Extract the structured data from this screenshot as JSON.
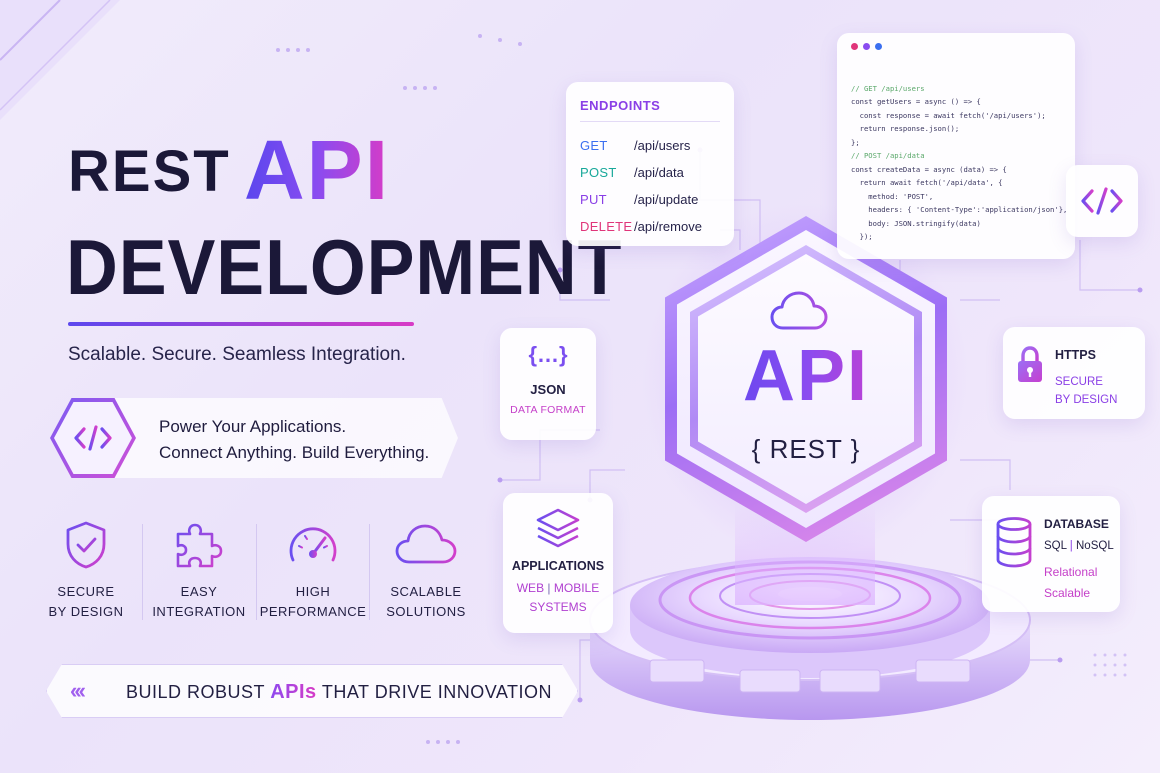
{
  "colors": {
    "accent_blue": "#5a46ee",
    "accent_purple": "#8a4cf0",
    "accent_pink": "#d83bc6",
    "dark_text": "#1b1838",
    "background": "#efe8fb"
  },
  "hero": {
    "rest": "REST",
    "api": "API",
    "development": "DEVELOPMENT",
    "tagline": "Scalable. Secure. Seamless Integration."
  },
  "power": {
    "icon": "code-icon",
    "line1": "Power Your Applications.",
    "line2": "Connect Anything. Build Everything."
  },
  "features": [
    {
      "icon": "shield-check-icon",
      "line1": "SECURE",
      "line2": "BY DESIGN"
    },
    {
      "icon": "puzzle-icon",
      "line1": "EASY",
      "line2": "INTEGRATION"
    },
    {
      "icon": "speedometer-icon",
      "line1": "HIGH",
      "line2": "PERFORMANCE"
    },
    {
      "icon": "cloud-icon",
      "line1": "SCALABLE",
      "line2": "SOLUTIONS"
    }
  ],
  "banner": {
    "chevrons": "‹‹‹",
    "pre": "BUILD ROBUST",
    "highlight": "APIs",
    "post": "THAT DRIVE INNOVATION"
  },
  "endpoints": {
    "title": "ENDPOINTS",
    "rows": [
      {
        "method": "GET",
        "path": "/api/users",
        "color": "#3b6ff0"
      },
      {
        "method": "POST",
        "path": "/api/data",
        "color": "#18a89a"
      },
      {
        "method": "PUT",
        "path": "/api/update",
        "color": "#8a3fe6"
      },
      {
        "method": "DELETE",
        "path": "/api/remove",
        "color": "#e0357a"
      }
    ]
  },
  "code": {
    "lines": [
      "// GET /api/users",
      "const getUsers = async () => {",
      "  const response = await fetch('/api/users');",
      "  return response.json();",
      "};",
      "",
      "// POST /api/data",
      "const createData = async (data) => {",
      "  return await fetch('/api/data', {",
      "    method: 'POST',",
      "    headers: { 'Content-Type':'application/json'},",
      "    body: JSON.stringify(data)",
      "  });"
    ]
  },
  "tag_icon": "code-icon",
  "json_card": {
    "icon": "{…}",
    "title": "JSON",
    "subtitle": "DATA FORMAT"
  },
  "https_card": {
    "icon": "lock-icon",
    "title": "HTTPS",
    "line1": "SECURE",
    "line2": "BY DESIGN"
  },
  "apps_card": {
    "icon": "layers-icon",
    "title": "APPLICATIONS",
    "web": "WEB",
    "mobile": "MOBILE",
    "systems": "SYSTEMS",
    "sep": "|"
  },
  "db_card": {
    "icon": "database-icon",
    "title": "DATABASE",
    "sql": "SQL",
    "nosql": "NoSQL",
    "sep": "|",
    "line1": "Relational",
    "line2": "Scalable"
  },
  "hexagon": {
    "icon": "cloud-icon",
    "api": "API",
    "rest": "{ REST }"
  }
}
